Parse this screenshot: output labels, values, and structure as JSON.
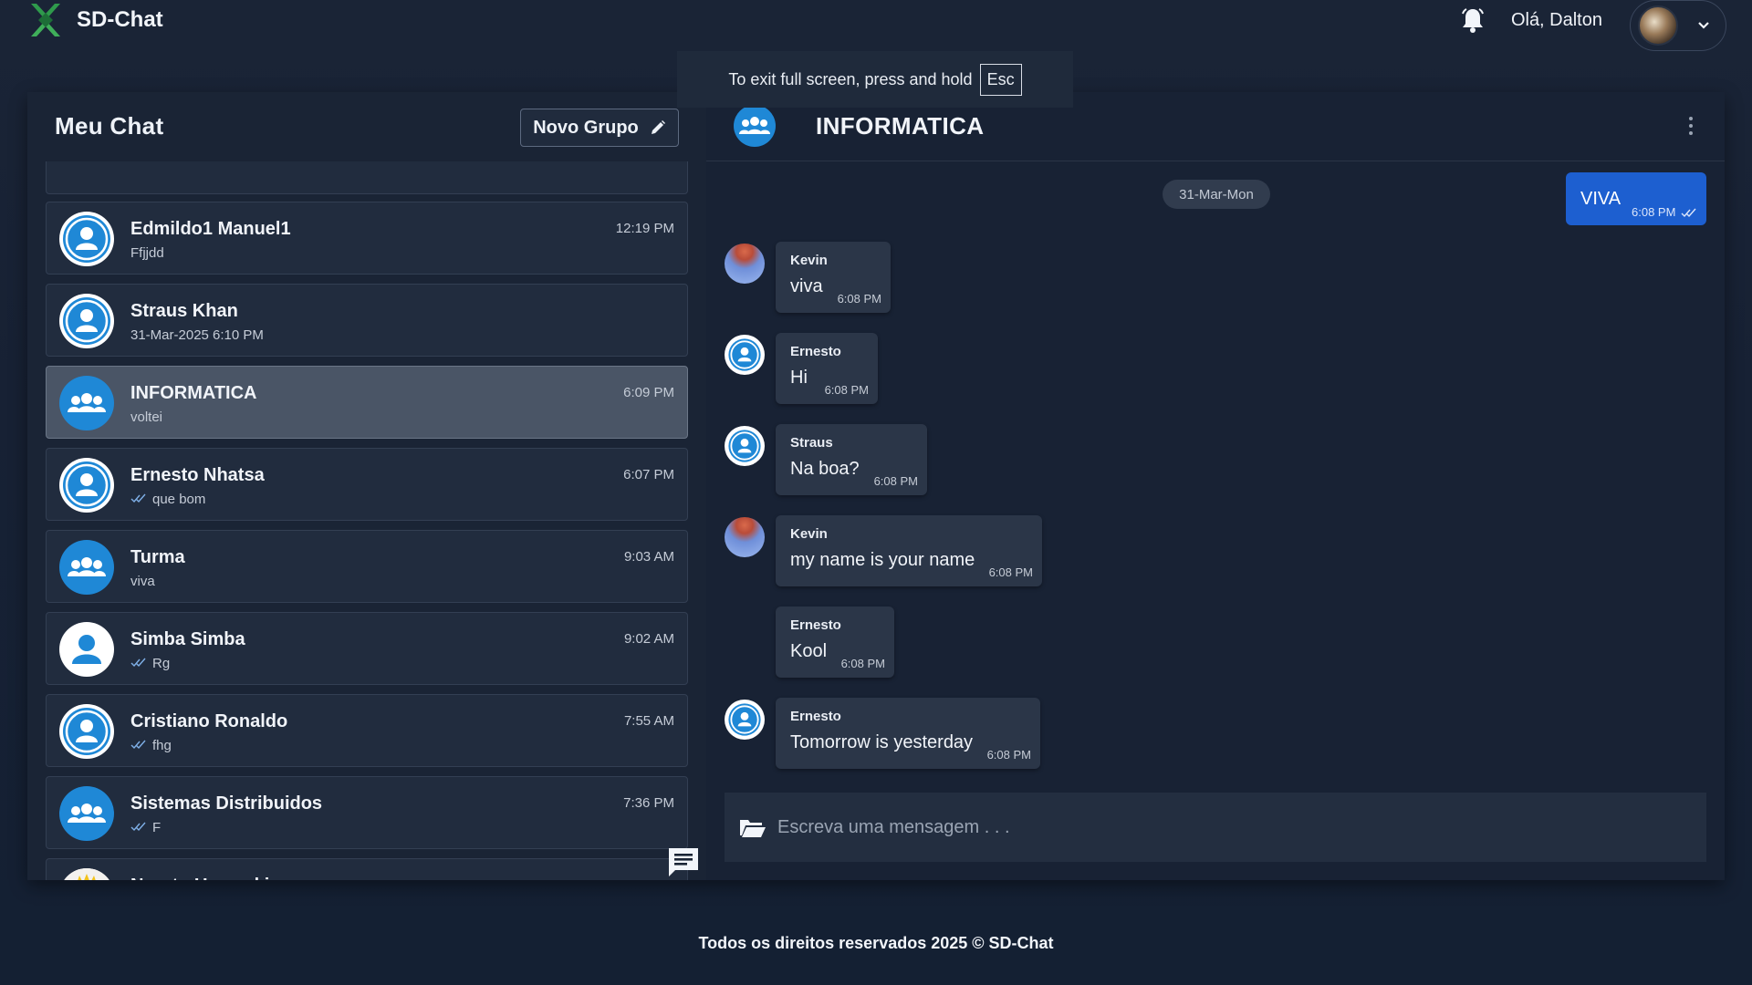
{
  "app": {
    "brand_name": "SD-Chat",
    "greeting": "Olá, Dalton",
    "toast_text": "To exit full screen, press and hold",
    "toast_key": "Esc"
  },
  "sidebar": {
    "title": "Meu Chat",
    "new_group_label": "Novo Grupo",
    "items": [
      {
        "name": "Edmildo1 Manuel1",
        "sub": "Ffjjdd",
        "time": "12:19 PM",
        "avatar": "person-icon",
        "check": false
      },
      {
        "name": "Straus Khan",
        "sub": "31-Mar-2025 6:10 PM",
        "time": "",
        "avatar": "person-icon",
        "check": false
      },
      {
        "name": "INFORMATICA",
        "sub": "voltei",
        "time": "6:09 PM",
        "avatar": "group-icon",
        "check": false
      },
      {
        "name": "Ernesto Nhatsa",
        "sub": "que bom",
        "time": "6:07 PM",
        "avatar": "person-icon",
        "check": true
      },
      {
        "name": "Turma",
        "sub": "viva",
        "time": "9:03 AM",
        "avatar": "group-icon",
        "check": false
      },
      {
        "name": "Simba Simba",
        "sub": "Rg",
        "time": "9:02 AM",
        "avatar": "person-icon",
        "check": true
      },
      {
        "name": "Cristiano Ronaldo",
        "sub": "fhg",
        "time": "7:55 AM",
        "avatar": "person-icon",
        "check": true
      },
      {
        "name": "Sistemas Distribuidos",
        "sub": "F",
        "time": "7:36 PM",
        "avatar": "group-icon",
        "check": true
      },
      {
        "name": "Naruto Uzumaki",
        "sub": "",
        "time": "",
        "avatar": "photo",
        "check": false
      }
    ]
  },
  "chat": {
    "title": "INFORMATICA",
    "date_divider": "31-Mar-Mon",
    "own_message": {
      "text": "VIVA",
      "time": "6:08 PM"
    },
    "messages": [
      {
        "sender": "Kevin",
        "text": "viva",
        "time": "6:08 PM",
        "avatar": "photo"
      },
      {
        "sender": "Ernesto",
        "text": "Hi",
        "time": "6:08 PM",
        "avatar": "person-icon"
      },
      {
        "sender": "Straus",
        "text": "Na boa?",
        "time": "6:08 PM",
        "avatar": "person-icon"
      },
      {
        "sender": "Kevin",
        "text": "my name is your name",
        "time": "6:08 PM",
        "avatar": "photo"
      },
      {
        "sender": "Ernesto",
        "text": "Kool",
        "time": "6:08 PM",
        "avatar": "none"
      },
      {
        "sender": "Ernesto",
        "text": "Tomorrow is yesterday",
        "time": "6:08 PM",
        "avatar": "person-icon"
      }
    ],
    "composer_placeholder": "Escreva uma mensagem . . ."
  },
  "footer": {
    "text": "Todos os direitos reservados 2025 © SD-Chat"
  },
  "colors": {
    "accent": "#1f88d6",
    "own_bubble": "#1d5fd0",
    "background": "#172134"
  }
}
